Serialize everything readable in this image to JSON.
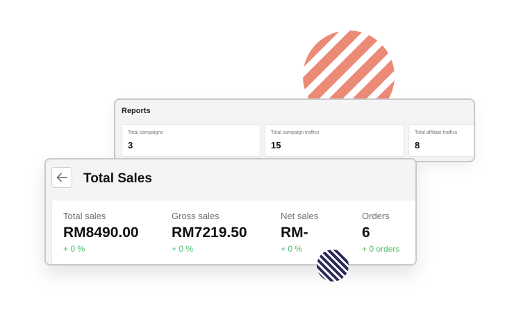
{
  "reports": {
    "title": "Reports",
    "tiles": [
      {
        "label": "Total campaigns",
        "value": "3"
      },
      {
        "label": "Total campaign traffics",
        "value": "15"
      },
      {
        "label": "Total affiliate traffics",
        "value": "8"
      }
    ]
  },
  "sales": {
    "title": "Total Sales",
    "metrics": [
      {
        "label": "Total sales",
        "value": "RM8490.00",
        "change": "+ 0 %"
      },
      {
        "label": "Gross sales",
        "value": "RM7219.50",
        "change": "+ 0 %"
      },
      {
        "label": "Net sales",
        "value": "RM-",
        "change": "+ 0 %"
      },
      {
        "label": "Orders",
        "value": "6",
        "change": "+ 0 orders"
      }
    ]
  },
  "colors": {
    "accent_coral": "#ec8a78",
    "accent_navy": "#2b2957",
    "positive_green": "#4cc06b"
  },
  "icons": {
    "back": "arrow-left-icon"
  }
}
